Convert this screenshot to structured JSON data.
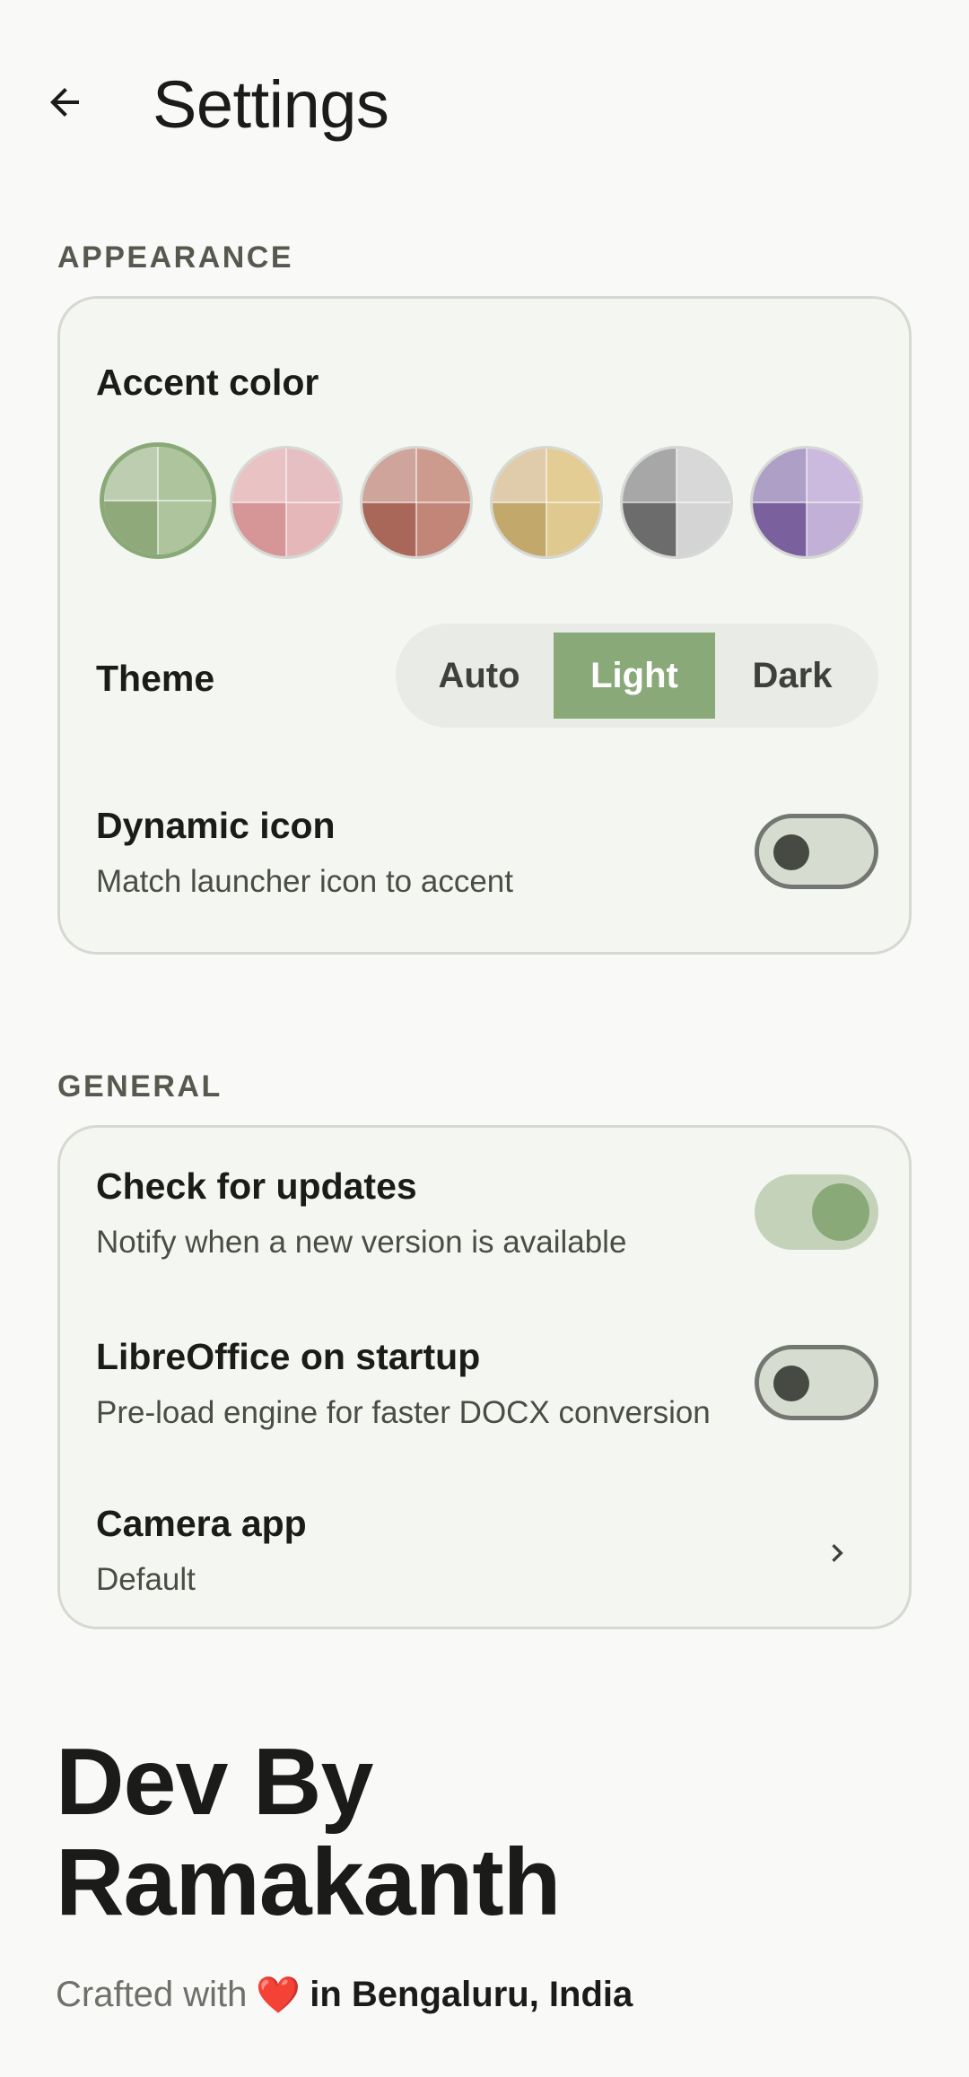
{
  "header": {
    "title": "Settings"
  },
  "appearance": {
    "section_label": "APPEARANCE",
    "accent": {
      "title": "Accent color",
      "swatches": [
        {
          "name": "green",
          "selected": true,
          "colors": [
            "#bdceb0",
            "#adc49c",
            "#8fa97a",
            "#adc49c"
          ]
        },
        {
          "name": "pink",
          "selected": false,
          "colors": [
            "#e9c2c4",
            "#e6bfc2",
            "#d69596",
            "#e6b7b9"
          ]
        },
        {
          "name": "rose",
          "selected": false,
          "colors": [
            "#cea49b",
            "#cd9a8e",
            "#a86758",
            "#c28678"
          ]
        },
        {
          "name": "gold",
          "selected": false,
          "colors": [
            "#e0ccaa",
            "#e3cd95",
            "#c2a86b",
            "#e0c98f"
          ]
        },
        {
          "name": "gray",
          "selected": false,
          "colors": [
            "#a7a7a7",
            "#d8d8d8",
            "#6c6c6c",
            "#d4d4d4"
          ]
        },
        {
          "name": "purple",
          "selected": false,
          "colors": [
            "#ad9fc6",
            "#cbbade",
            "#7a619e",
            "#c2b0d6"
          ]
        }
      ]
    },
    "theme": {
      "title": "Theme",
      "options": [
        "Auto",
        "Light",
        "Dark"
      ],
      "selected": "Light"
    },
    "dynamic_icon": {
      "title": "Dynamic icon",
      "subtitle": "Match launcher icon to accent",
      "enabled": false
    }
  },
  "general": {
    "section_label": "GENERAL",
    "check_updates": {
      "title": "Check for updates",
      "subtitle": "Notify when a new version is available",
      "enabled": true
    },
    "libreoffice": {
      "title": "LibreOffice on startup",
      "subtitle": "Pre-load engine for faster DOCX conversion",
      "enabled": false
    },
    "camera": {
      "title": "Camera app",
      "subtitle": "Default"
    }
  },
  "footer": {
    "dev_line1": "Dev By",
    "dev_line2": "Ramakanth",
    "crafted_prefix": "Crafted with",
    "heart": "❤️",
    "crafted_location": "in Bengaluru, India"
  },
  "colors": {
    "accent": "#8aa978",
    "card_bg": "#f4f6f1",
    "card_border": "#d6d9d0",
    "page_bg": "#f9f9f8",
    "heart": "#e53935"
  }
}
